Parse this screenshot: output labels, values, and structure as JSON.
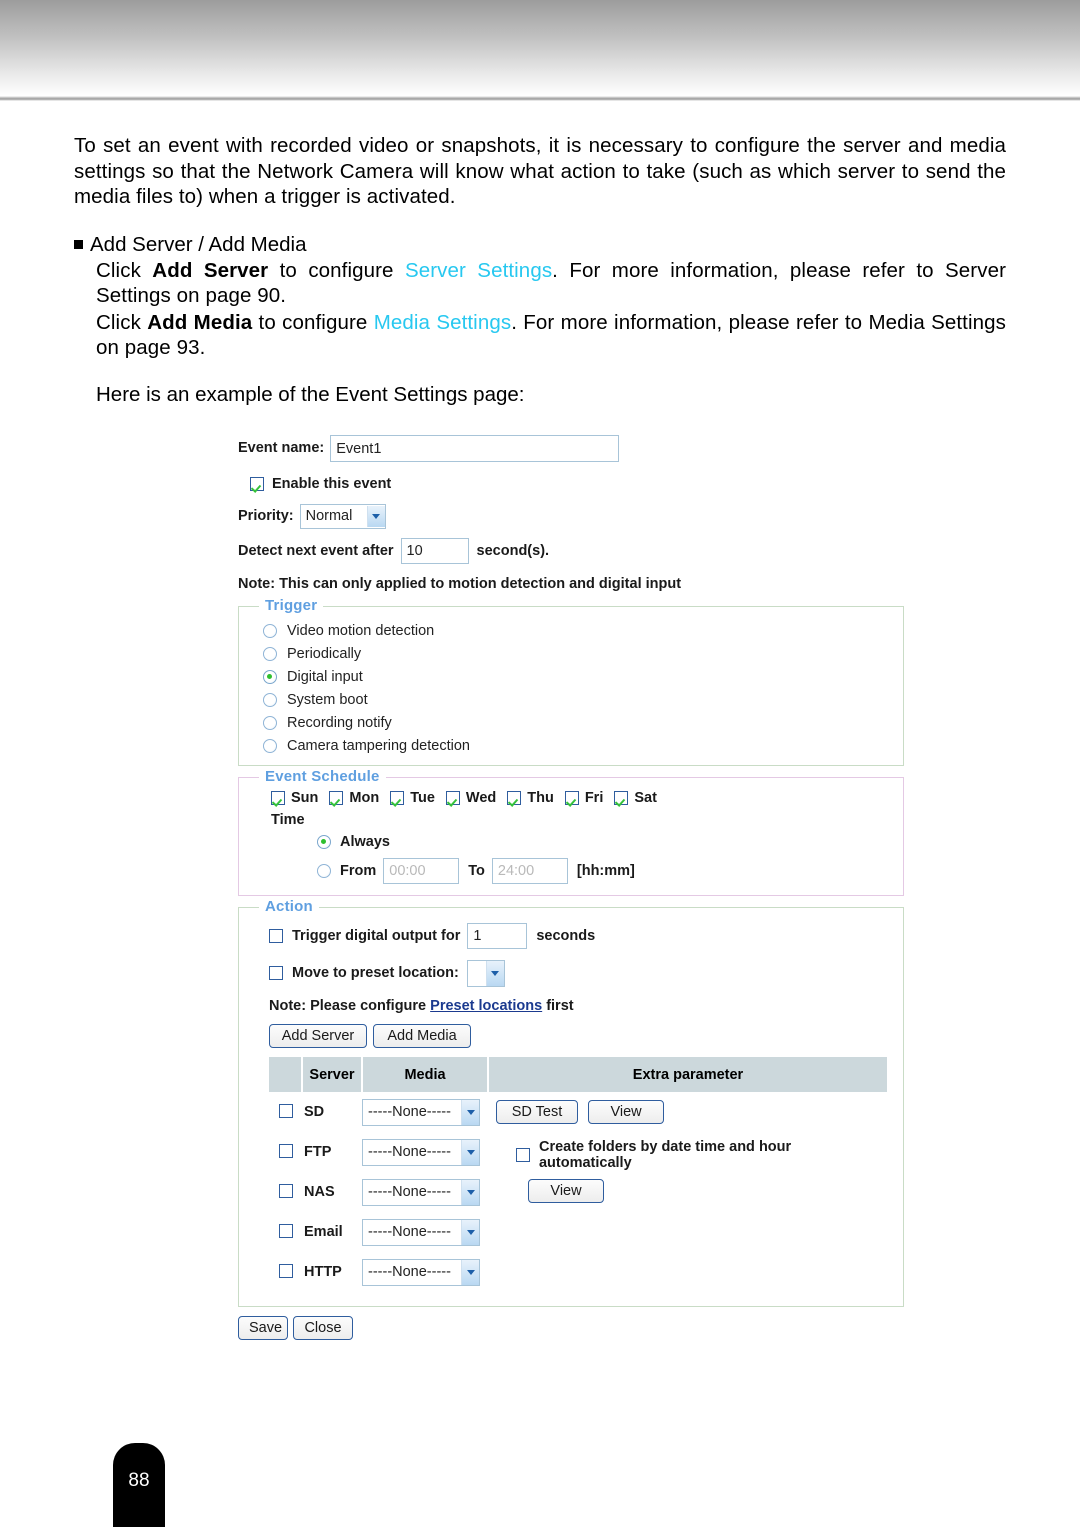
{
  "document": {
    "page_number": "88",
    "intro_paragraph": "To set an event with recorded video or snapshots, it is necessary to configure the server and media settings so that the Network Camera will know what action to take (such as which server to send the media files to) when a trigger is activated.",
    "bullet_heading": "Add Server / Add Media",
    "server_line": {
      "part1": "Click ",
      "bold1": "Add Server",
      "part2": " to configure ",
      "link": "Server Settings",
      "part3": ". For more information, please refer to Server Settings on page 90."
    },
    "media_line": {
      "part1": "Click ",
      "bold1": "Add Media",
      "part2": " to configure ",
      "link": "Media Settings",
      "part3": ". For more information, please refer to Media Settings on page 93."
    },
    "example_line": "Here is an example of the Event Settings page:",
    "link_color": "#27c8f0"
  },
  "event_form": {
    "event_name_label": "Event name:",
    "event_name_value": "Event1",
    "enable_label": "Enable this event",
    "enable_checked": true,
    "priority_label": "Priority:",
    "priority_value": "Normal",
    "priority_options": [
      "Normal"
    ],
    "detect_prefix": "Detect next event after",
    "detect_value": "10",
    "detect_suffix": "second(s).",
    "note": "Note: This can only applied to motion detection and digital input",
    "trigger": {
      "legend": "Trigger",
      "selected": "Digital input",
      "options": [
        "Video motion detection",
        "Periodically",
        "Digital input",
        "System boot",
        "Recording notify",
        "Camera tampering detection"
      ]
    },
    "schedule": {
      "legend": "Event Schedule",
      "days": [
        {
          "label": "Sun",
          "checked": true
        },
        {
          "label": "Mon",
          "checked": true
        },
        {
          "label": "Tue",
          "checked": true
        },
        {
          "label": "Wed",
          "checked": true
        },
        {
          "label": "Thu",
          "checked": true
        },
        {
          "label": "Fri",
          "checked": true
        },
        {
          "label": "Sat",
          "checked": true
        }
      ],
      "time_label": "Time",
      "always_label": "Always",
      "always_selected": true,
      "from_label": "From",
      "from_placeholder": "00:00",
      "to_label": "To",
      "to_placeholder": "24:00",
      "format_hint": "[hh:mm]"
    },
    "action": {
      "legend": "Action",
      "trigger_do_label": "Trigger digital output for",
      "trigger_do_checked": false,
      "trigger_do_value": "1",
      "trigger_do_suffix": "seconds",
      "preset_label": "Move to preset location:",
      "preset_checked": false,
      "preset_value": "",
      "preset_note_prefix": "Note: Please configure ",
      "preset_note_link": "Preset locations",
      "preset_note_suffix": " first",
      "add_server_button": "Add Server",
      "add_media_button": "Add Media",
      "table": {
        "headers": [
          "",
          "Server",
          "Media",
          "Extra parameter"
        ],
        "rows": [
          {
            "checked": false,
            "server": "SD",
            "media": "-----None-----",
            "extra_buttons": [
              "SD Test",
              "View"
            ],
            "extra_checkbox": null,
            "extra_checkbox_checked": false
          },
          {
            "checked": false,
            "server": "FTP",
            "media": "-----None-----",
            "extra_buttons": [],
            "extra_checkbox": "Create folders by date time and hour automatically",
            "extra_checkbox_checked": false
          },
          {
            "checked": false,
            "server": "NAS",
            "media": "-----None-----",
            "extra_buttons": [
              "View"
            ],
            "extra_checkbox": null,
            "extra_checkbox_checked": false
          },
          {
            "checked": false,
            "server": "Email",
            "media": "-----None-----",
            "extra_buttons": [],
            "extra_checkbox": null,
            "extra_checkbox_checked": false
          },
          {
            "checked": false,
            "server": "HTTP",
            "media": "-----None-----",
            "extra_buttons": [],
            "extra_checkbox": null,
            "extra_checkbox_checked": false
          }
        ]
      }
    },
    "save_button": "Save",
    "close_button": "Close"
  }
}
